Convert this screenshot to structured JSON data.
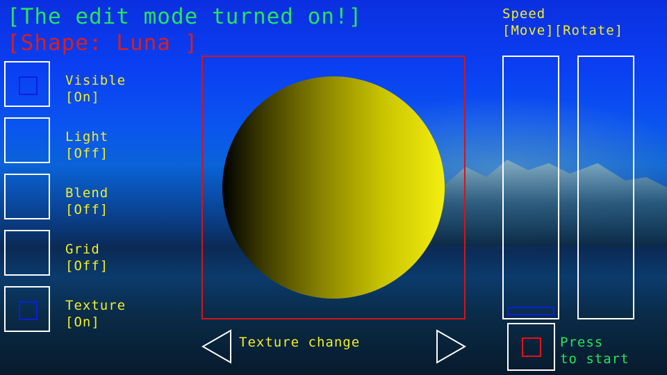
{
  "header": {
    "edit_mode": "[The edit mode  turned on!]",
    "shape": "[Shape: Luna  ]"
  },
  "toggles": [
    {
      "name": "Visible",
      "state": "[On]",
      "on": true
    },
    {
      "name": "Light",
      "state": "[Off]",
      "on": false
    },
    {
      "name": "Blend",
      "state": "[Off]",
      "on": false
    },
    {
      "name": "Grid",
      "state": "[Off]",
      "on": false
    },
    {
      "name": "Texture",
      "state": "[On]",
      "on": true
    }
  ],
  "texture": {
    "label": "Texture change"
  },
  "speed": {
    "title": "Speed",
    "subtitle": "[Move][Rotate]",
    "move_level": 0.0,
    "rotate_level": 0.0
  },
  "start": {
    "label_line1": "Press",
    "label_line2": "to start"
  },
  "colors": {
    "title_green": "#27e35c",
    "shape_red": "#d91f1f",
    "label_yellow": "#f2ef2a",
    "sphere_yellow": "#f3ee10"
  }
}
